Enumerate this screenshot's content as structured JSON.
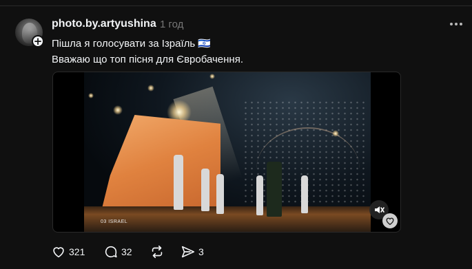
{
  "post": {
    "username": "photo.by.artyushina",
    "time": "1 год",
    "text_line1": "Пішла я голосувати за Ізраїль 🇮🇱",
    "text_line2": "Вважаю що топ пісня для Євробачення."
  },
  "media": {
    "caption_tag": "03 ISRAEL",
    "muted": true
  },
  "actions": {
    "likes": "321",
    "replies": "32",
    "shares": "3"
  },
  "icons": {
    "more": "more-dots-icon",
    "like": "heart-icon",
    "reply": "comment-icon",
    "repost": "repost-icon",
    "share": "send-icon",
    "mute": "speaker-muted-icon"
  },
  "colors": {
    "background": "#101010",
    "text": "#f3f5f7",
    "muted_text": "#777777"
  }
}
